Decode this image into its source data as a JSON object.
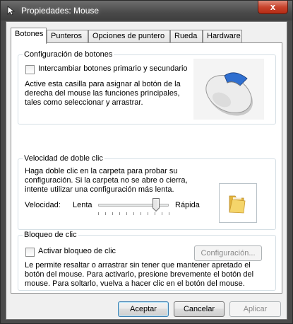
{
  "window": {
    "title": "Propiedades: Mouse",
    "close_glyph": "x"
  },
  "tabs": [
    {
      "label": "Botones",
      "active": true
    },
    {
      "label": "Punteros",
      "active": false
    },
    {
      "label": "Opciones de puntero",
      "active": false
    },
    {
      "label": "Rueda",
      "active": false
    },
    {
      "label": "Hardware",
      "active": false
    }
  ],
  "button_config": {
    "legend": "Configuración de botones",
    "swap_label": "Intercambiar botones primario y secundario",
    "swap_checked": false,
    "description_lines": [
      "Active esta casilla para asignar al botón de la",
      "derecha del mouse las funciones principales,",
      "tales como seleccionar y arrastrar."
    ]
  },
  "double_click": {
    "legend": "Velocidad de doble clic",
    "description_lines": [
      "Haga doble clic en la carpeta para probar su",
      "configuración. Si la carpeta no se abre o cierra,",
      "intente utilizar una configuración más lenta."
    ],
    "speed_label": "Velocidad:",
    "slow_label": "Lenta",
    "fast_label": "Rápida",
    "slider_value_fraction": 0.82
  },
  "click_lock": {
    "legend": "Bloqueo de clic",
    "activate_label": "Activar bloqueo de clic",
    "activate_checked": false,
    "config_button": "Configuración...",
    "description_lines": [
      "Le permite resaltar o arrastrar sin tener que mantener apretado el",
      "botón del mouse. Para activarlo, presione brevemente el botón del",
      "mouse. Para soltarlo, vuelva a hacer clic en el botón del mouse."
    ]
  },
  "footer": {
    "accept": "Aceptar",
    "cancel": "Cancelar",
    "apply": "Aplicar"
  },
  "colors": {
    "mouse_accent": "#2f6fd0",
    "folder": "#f2c94c"
  }
}
